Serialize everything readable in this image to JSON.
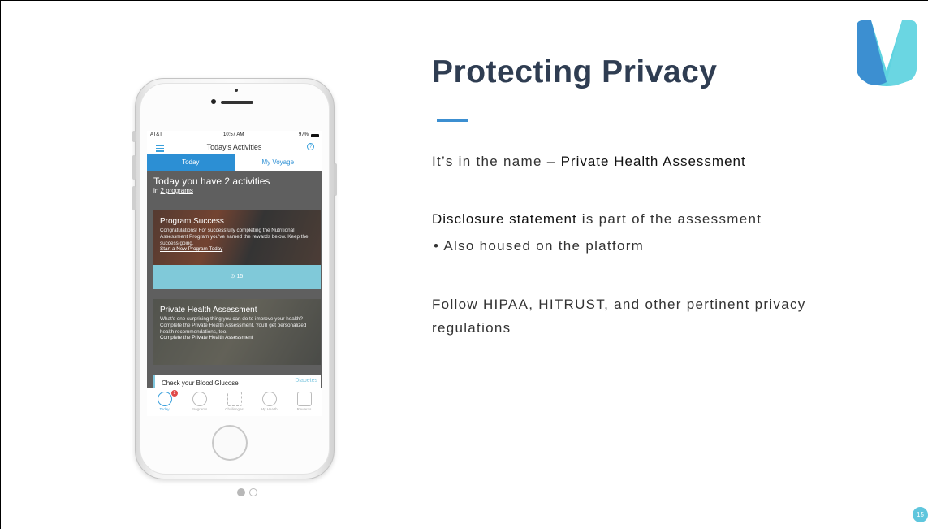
{
  "slide": {
    "title": "Protecting Privacy",
    "page_number": "15",
    "logo_colors": {
      "left": "#3c8fd1",
      "right": "#5fd3e0"
    },
    "pager": {
      "pages": 2,
      "active": 1
    }
  },
  "content": {
    "line1_prefix": "It’s in the name – ",
    "line1_bold": "Private Health Assessment",
    "line2_bold": "Disclosure statement",
    "line2_rest": " is part of the assessment",
    "bullet1": "• Also housed on the platform",
    "line3": "Follow HIPAA, HITRUST, and other pertinent privacy regulations"
  },
  "phone": {
    "status": {
      "carrier": "AT&T",
      "time": "10:57 AM",
      "battery": "97%"
    },
    "nav_title": "Today's Activities",
    "help_icon": "?",
    "tabs": [
      {
        "label": "Today"
      },
      {
        "label": "My Voyage"
      }
    ],
    "summary": {
      "headline": "Today you have 2 activities",
      "prefix": "in ",
      "link": "2 programs"
    },
    "cards": [
      {
        "title": "Program Success",
        "text": "Congratulations! For successfully completing the Nutritional Assessment Program you've earned the rewards below. Keep the success going.",
        "link": "Start a New Program Today",
        "reward": "⊙ 15"
      },
      {
        "title": "Private Health Assessment",
        "text": "What's one surprising thing you can do to improve your health? Complete the Private Health Assessment. You'll get personalized health recommendations, too.",
        "link": "Complete the Private Health Assessment"
      }
    ],
    "upcoming": {
      "label": "Check your Blood Glucose",
      "tag": "Diabetes"
    },
    "bottom_nav": [
      {
        "label": "Today",
        "icon": "compass-icon",
        "badge": "2"
      },
      {
        "label": "Programs",
        "icon": "target-icon"
      },
      {
        "label": "Challenges",
        "icon": "flags-icon"
      },
      {
        "label": "My Health",
        "icon": "person-icon"
      },
      {
        "label": "Rewards",
        "icon": "gift-icon"
      }
    ]
  }
}
